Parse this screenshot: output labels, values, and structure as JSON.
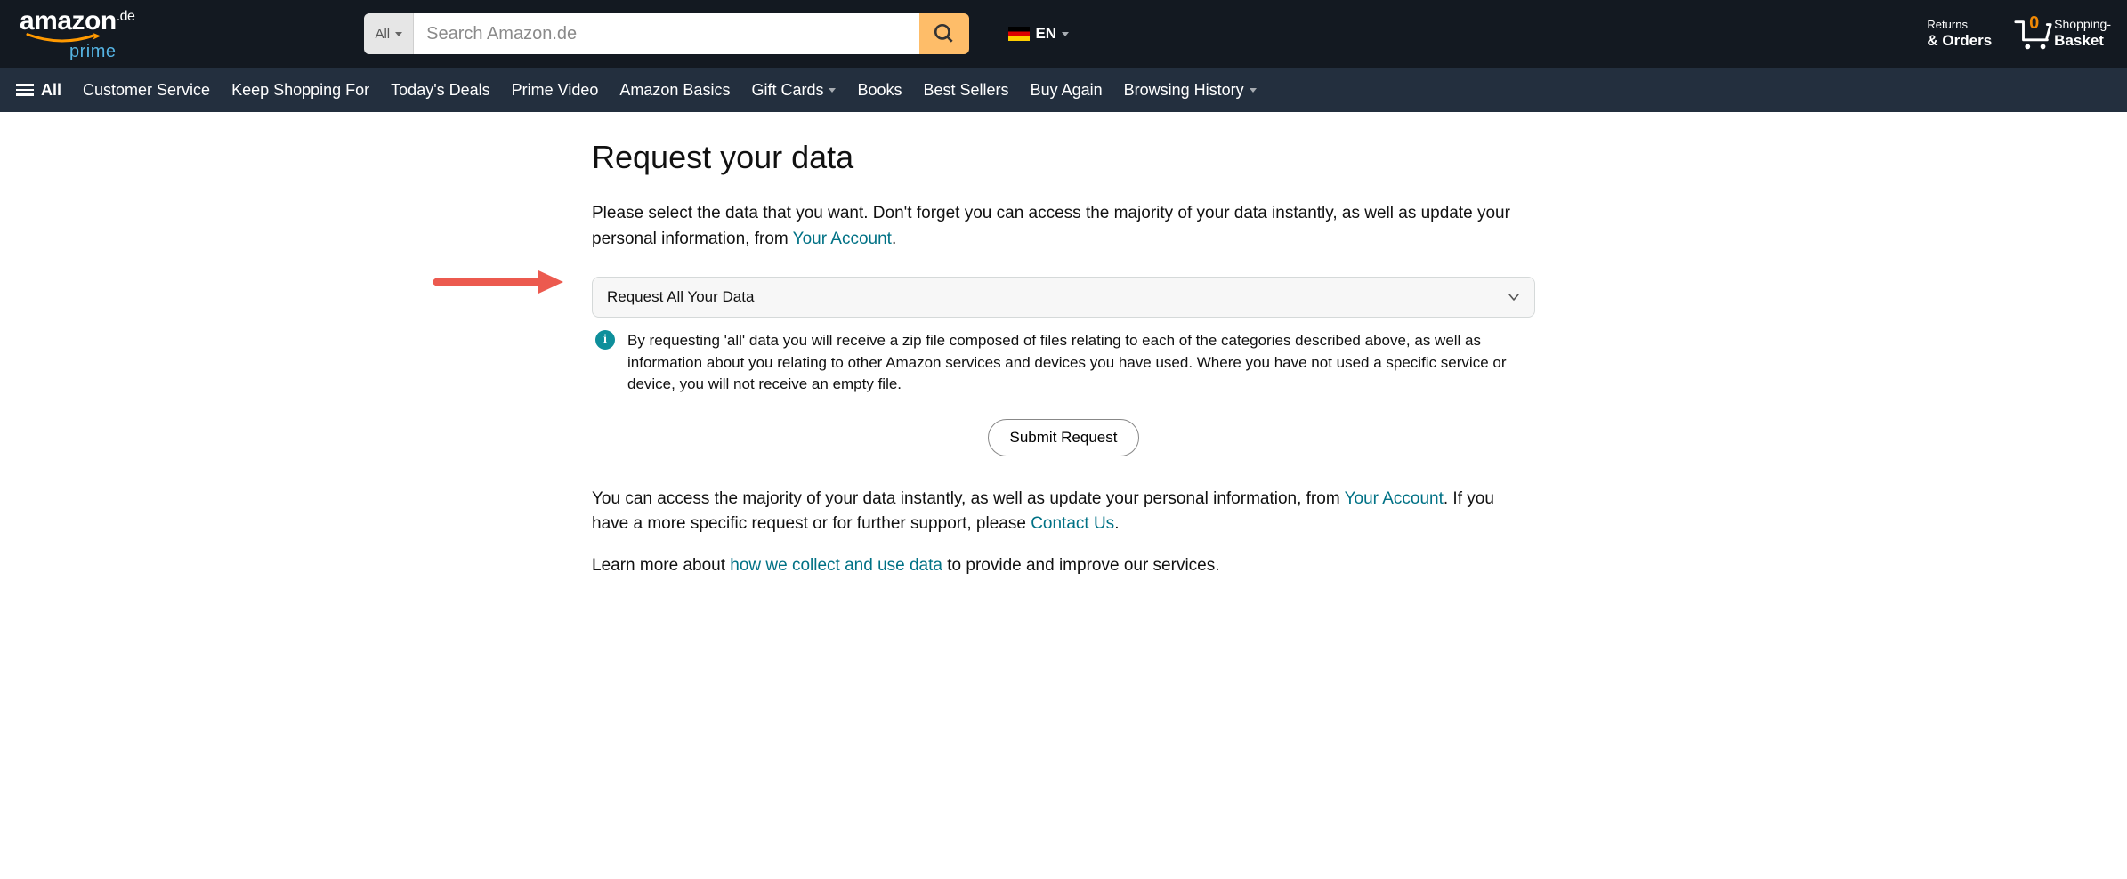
{
  "header": {
    "logo_text": "amazon",
    "logo_suffix": ".de",
    "logo_sub": "prime",
    "search_scope": "All",
    "search_placeholder": "Search Amazon.de",
    "lang": "EN",
    "returns_l1": "Returns",
    "returns_l2": "& Orders",
    "cart_count": "0",
    "cart_l1": "Shopping-",
    "cart_l2": "Basket"
  },
  "nav": {
    "all": "All",
    "items": [
      "Customer Service",
      "Keep Shopping For",
      "Today's Deals",
      "Prime Video",
      "Amazon Basics",
      "Gift Cards",
      "Books",
      "Best Sellers",
      "Buy Again",
      "Browsing History"
    ]
  },
  "page": {
    "title": "Request your data",
    "intro_pre": "Please select the data that you want. Don't forget you can access the majority of your data instantly, as well as update your personal information, from ",
    "intro_link": "Your Account",
    "intro_post": ".",
    "select_value": "Request All Your Data",
    "info_text": "By requesting 'all' data you will receive a zip file composed of files relating to each of the categories described above, as well as information about you relating to other Amazon services and devices you have used. Where you have not used a specific service or device, you will not receive an empty file.",
    "submit_label": "Submit Request",
    "p2_a": "You can access the majority of your data instantly, as well as update your personal information, from ",
    "p2_link1": "Your Account",
    "p2_b": ". If you have a more specific request or for further support, please ",
    "p2_link2": "Contact Us",
    "p2_c": ".",
    "p3_a": "Learn more about ",
    "p3_link": "how we collect and use data",
    "p3_b": " to provide and improve our services."
  }
}
